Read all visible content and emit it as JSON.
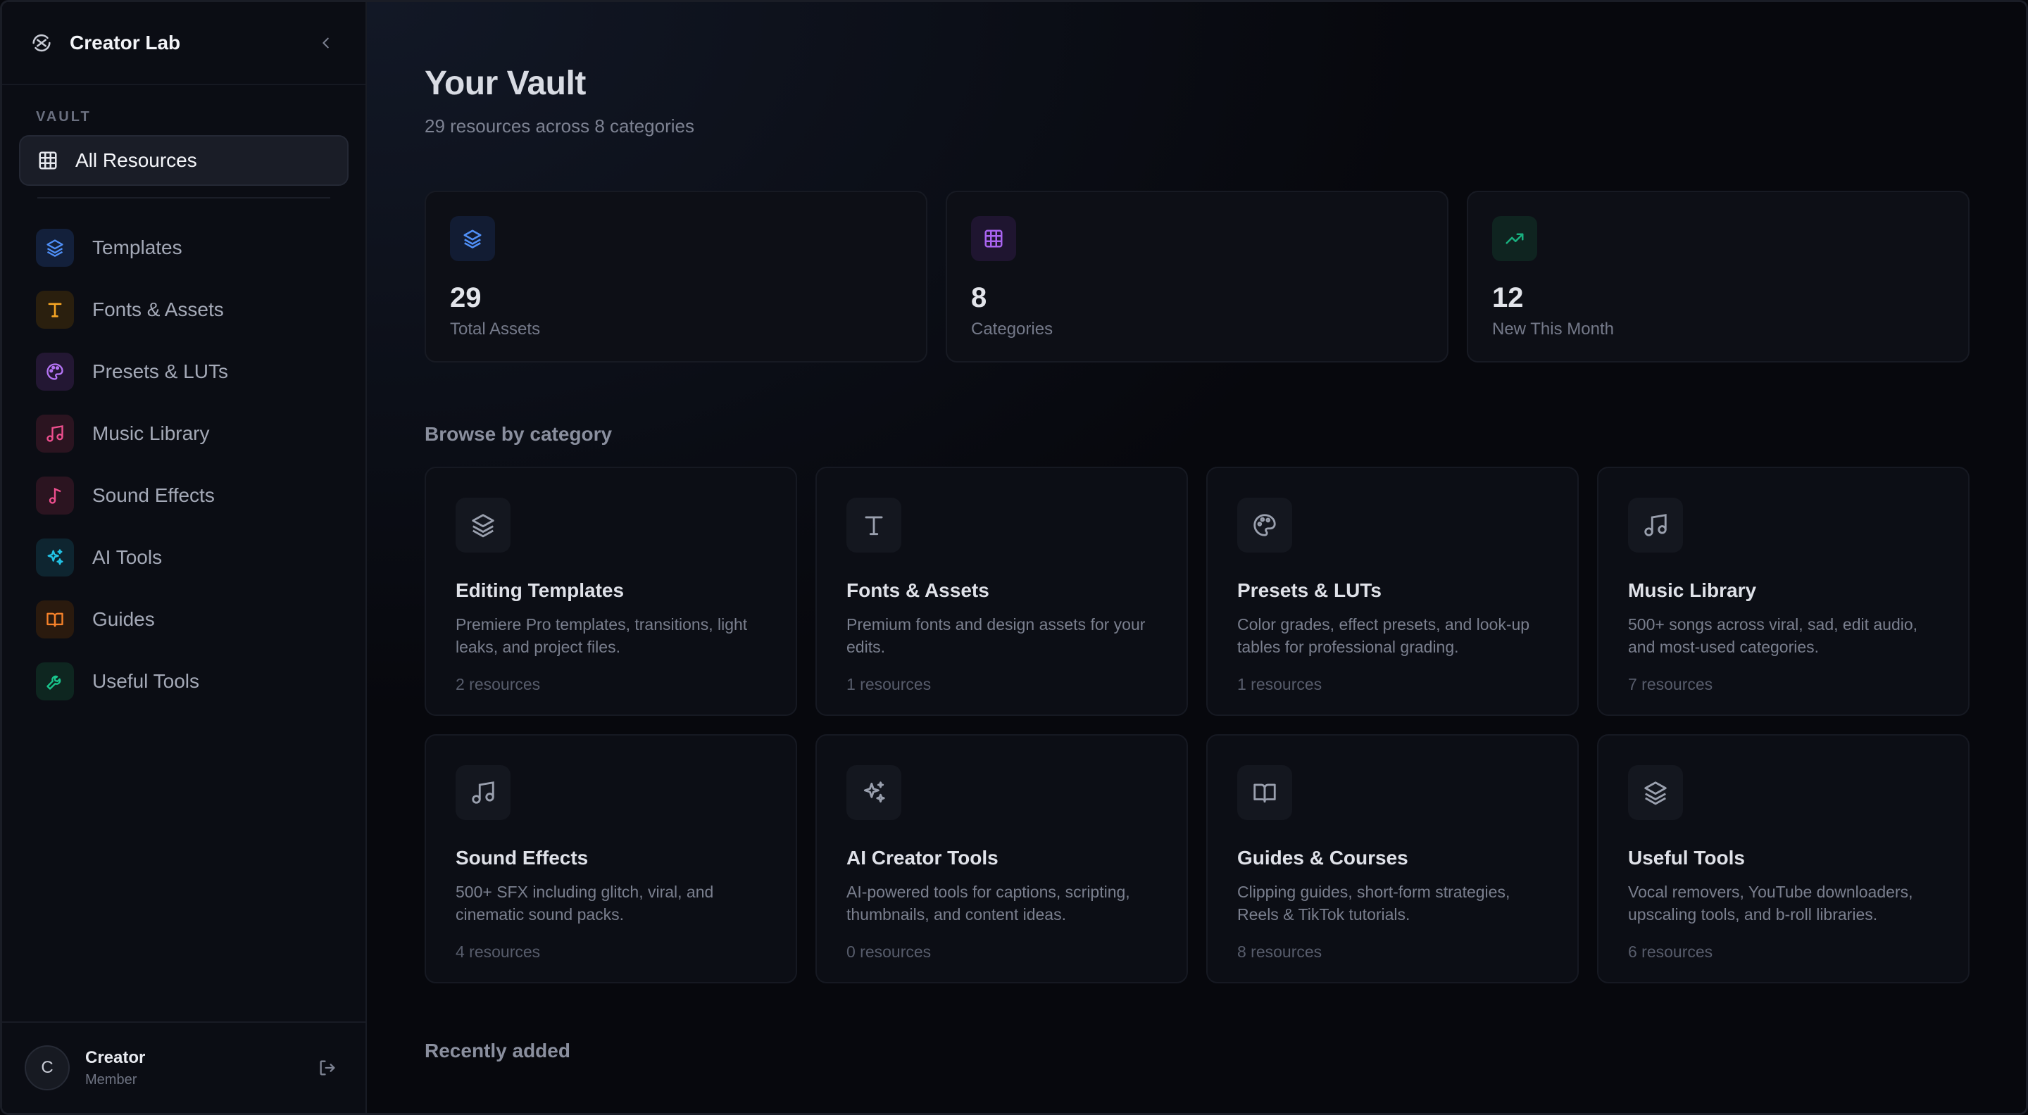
{
  "brand": {
    "name": "Creator Lab"
  },
  "sidebar": {
    "section_label": "VAULT",
    "all_resources": "All Resources",
    "items": [
      {
        "label": "Templates",
        "icon": "layers-icon",
        "color": "#3b82f6"
      },
      {
        "label": "Fonts & Assets",
        "icon": "type-icon",
        "color": "#f59e0b"
      },
      {
        "label": "Presets & LUTs",
        "icon": "palette-icon",
        "color": "#a855f7"
      },
      {
        "label": "Music Library",
        "icon": "music-icon",
        "color": "#ec4899"
      },
      {
        "label": "Sound Effects",
        "icon": "music-note-icon",
        "color": "#ec4899"
      },
      {
        "label": "AI Tools",
        "icon": "sparkles-icon",
        "color": "#06b6d4"
      },
      {
        "label": "Guides",
        "icon": "book-icon",
        "color": "#f97316"
      },
      {
        "label": "Useful Tools",
        "icon": "wrench-icon",
        "color": "#10b981"
      }
    ]
  },
  "user": {
    "initial": "C",
    "name": "Creator",
    "role": "Member"
  },
  "main": {
    "title": "Your Vault",
    "subtitle": "29 resources across 8 categories",
    "stats": [
      {
        "value": "29",
        "label": "Total Assets",
        "icon": "layers-icon",
        "color": "#3b82f6"
      },
      {
        "value": "8",
        "label": "Categories",
        "icon": "grid-icon",
        "color": "#a855f7"
      },
      {
        "value": "12",
        "label": "New This Month",
        "icon": "trending-up-icon",
        "color": "#10b981"
      }
    ],
    "browse_title": "Browse by category",
    "categories": [
      {
        "title": "Editing Templates",
        "desc": "Premiere Pro templates, transitions, light leaks, and project files.",
        "count": "2 resources",
        "icon": "layers-icon"
      },
      {
        "title": "Fonts & Assets",
        "desc": "Premium fonts and design assets for your edits.",
        "count": "1 resources",
        "icon": "type-icon"
      },
      {
        "title": "Presets & LUTs",
        "desc": "Color grades, effect presets, and look-up tables for professional grading.",
        "count": "1 resources",
        "icon": "palette-icon"
      },
      {
        "title": "Music Library",
        "desc": "500+ songs across viral, sad, edit audio, and most-used categories.",
        "count": "7 resources",
        "icon": "music-icon"
      },
      {
        "title": "Sound Effects",
        "desc": "500+ SFX including glitch, viral, and cinematic sound packs.",
        "count": "4 resources",
        "icon": "music-icon"
      },
      {
        "title": "AI Creator Tools",
        "desc": "AI-powered tools for captions, scripting, thumbnails, and content ideas.",
        "count": "0 resources",
        "icon": "sparkles-icon"
      },
      {
        "title": "Guides & Courses",
        "desc": "Clipping guides, short-form strategies, Reels & TikTok tutorials.",
        "count": "8 resources",
        "icon": "book-icon"
      },
      {
        "title": "Useful Tools",
        "desc": "Vocal removers, YouTube downloaders, upscaling tools, and b-roll libraries.",
        "count": "6 resources",
        "icon": "layers-icon"
      }
    ],
    "recent_title": "Recently added"
  }
}
